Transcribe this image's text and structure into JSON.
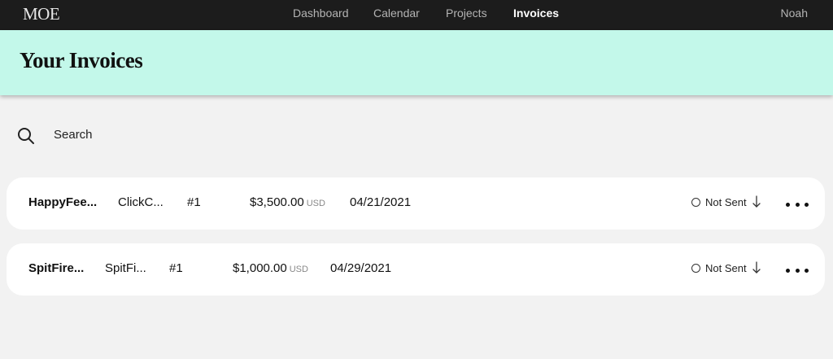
{
  "app": {
    "logo": "MOE",
    "user": "Noah"
  },
  "nav": {
    "items": [
      {
        "label": "Dashboard"
      },
      {
        "label": "Calendar"
      },
      {
        "label": "Projects"
      },
      {
        "label": "Invoices",
        "active": true
      }
    ]
  },
  "page": {
    "title": "Your Invoices"
  },
  "search": {
    "placeholder": "Search",
    "icon": "search-icon"
  },
  "invoices": [
    {
      "client": "HappyFee...",
      "project": "ClickC...",
      "number": "#1",
      "amount": "$3,500.00",
      "currency": "USD",
      "date": "04/21/2021",
      "status": "Not Sent"
    },
    {
      "client": "SpitFire...",
      "project": "SpitFi...",
      "number": "#1",
      "amount": "$1,000.00",
      "currency": "USD",
      "date": "04/29/2021",
      "status": "Not Sent"
    }
  ],
  "colors": {
    "nav_bg": "#1c1c1c",
    "banner_bg": "#c3f8ea",
    "page_bg": "#f2f2f2",
    "row_bg": "#ffffff"
  }
}
